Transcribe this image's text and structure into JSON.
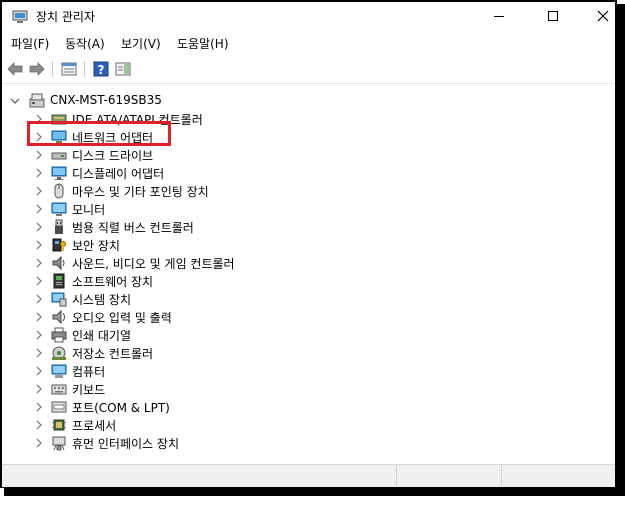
{
  "window": {
    "title": "장치 관리자",
    "controls": {
      "minimize": "minimize",
      "maximize": "maximize",
      "close": "close"
    }
  },
  "menu": [
    {
      "label": "파일(F)"
    },
    {
      "label": "동작(A)"
    },
    {
      "label": "보기(V)"
    },
    {
      "label": "도움말(H)"
    }
  ],
  "toolbar": {
    "buttons": [
      "back-arrow-icon",
      "forward-arrow-icon",
      "properties-icon",
      "help-icon",
      "action-panel-icon"
    ]
  },
  "tree": {
    "root": {
      "label": "CNX-MST-619SB35",
      "expanded": true,
      "icon": "computer-icon"
    },
    "children": [
      {
        "label": "IDE ATA/ATAPI 컨트롤러",
        "icon": "ide-controller-icon"
      },
      {
        "label": "네트워크 어댑터",
        "icon": "network-adapter-icon",
        "highlighted": true
      },
      {
        "label": "디스크 드라이브",
        "icon": "disk-drive-icon"
      },
      {
        "label": "디스플레이 어댑터",
        "icon": "display-adapter-icon"
      },
      {
        "label": "마우스 및 기타 포인팅 장치",
        "icon": "mouse-icon"
      },
      {
        "label": "모니터",
        "icon": "monitor-icon"
      },
      {
        "label": "범용 직렬 버스 컨트롤러",
        "icon": "usb-icon"
      },
      {
        "label": "보안 장치",
        "icon": "security-device-icon"
      },
      {
        "label": "사운드, 비디오 및 게임 컨트롤러",
        "icon": "sound-icon"
      },
      {
        "label": "소프트웨어 장치",
        "icon": "software-device-icon"
      },
      {
        "label": "시스템 장치",
        "icon": "system-device-icon"
      },
      {
        "label": "오디오 입력 및 출력",
        "icon": "audio-icon"
      },
      {
        "label": "인쇄 대기열",
        "icon": "printer-icon"
      },
      {
        "label": "저장소 컨트롤러",
        "icon": "storage-controller-icon"
      },
      {
        "label": "컴퓨터",
        "icon": "computer-node-icon"
      },
      {
        "label": "키보드",
        "icon": "keyboard-icon"
      },
      {
        "label": "포트(COM & LPT)",
        "icon": "port-icon"
      },
      {
        "label": "프로세서",
        "icon": "processor-icon"
      },
      {
        "label": "휴먼 인터페이스 장치",
        "icon": "hid-icon"
      }
    ]
  },
  "colors": {
    "highlight_border": "#e0212b",
    "monitor_blue": "#2f8fd6",
    "chevron": "#707070"
  }
}
